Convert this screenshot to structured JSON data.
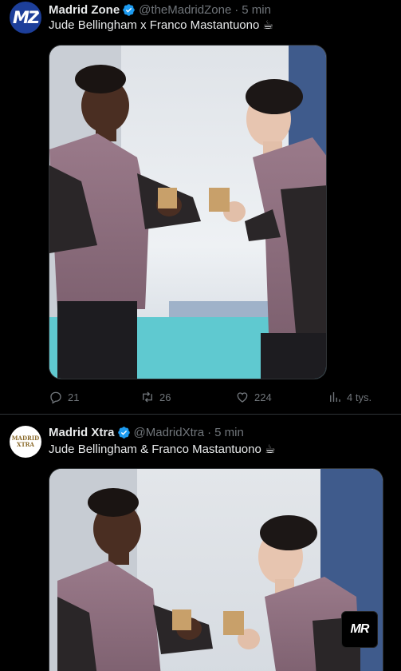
{
  "tweets": [
    {
      "avatar_text": "MZ",
      "name": "Madrid Zone",
      "handle": "@theMadridZone",
      "separator": "·",
      "time": "5 min",
      "text": "Jude Bellingham x Franco Mastantuono ☕",
      "replies": "21",
      "retweets": "26",
      "likes": "224",
      "views": "4 tys."
    },
    {
      "avatar_text_top": "MADRID",
      "avatar_text_bottom": "XTRA",
      "name": "Madrid Xtra",
      "handle": "@MadridXtra",
      "separator": "·",
      "time": "5 min",
      "text": "Jude Bellingham & Franco Mastantuono ☕",
      "watermark": "MR"
    }
  ],
  "colors": {
    "background": "#000000",
    "text": "#e7e9ea",
    "muted": "#71767b",
    "verified": "#1d9bf0",
    "divider": "#2f3336"
  },
  "icons": [
    "verified-icon",
    "reply-icon",
    "retweet-icon",
    "like-icon",
    "views-icon"
  ]
}
